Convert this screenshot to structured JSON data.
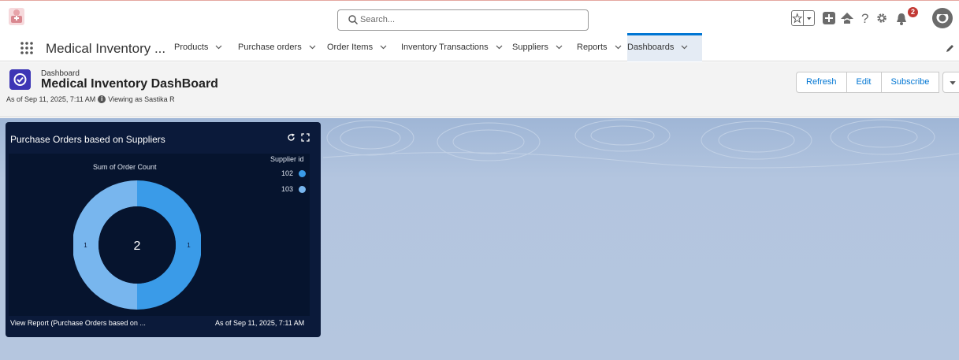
{
  "topbar": {
    "search_placeholder": "Search...",
    "notification_count": "2",
    "icons": [
      "app-logo-icon",
      "search-icon",
      "favorites-star-icon",
      "favorites-dropdown-icon",
      "global-actions-plus-icon",
      "trailhead-icon",
      "help-icon",
      "setup-gear-icon",
      "notifications-bell-icon",
      "user-avatar-icon"
    ]
  },
  "navbar": {
    "app_name": "Medical Inventory ...",
    "items": [
      {
        "label": "Products"
      },
      {
        "label": "Purchase orders"
      },
      {
        "label": "Order Items"
      },
      {
        "label": "Inventory Transactions"
      },
      {
        "label": "Suppliers"
      },
      {
        "label": "Reports"
      },
      {
        "label": "Dashboards"
      }
    ],
    "active_item": "Dashboards"
  },
  "header": {
    "subtitle": "Dashboard",
    "title": "Medical Inventory DashBoard",
    "as_of": "As of Sep 11, 2025, 7:11 AM",
    "viewing_as": "Viewing as Sastika R",
    "buttons": {
      "refresh": "Refresh",
      "edit": "Edit",
      "subscribe": "Subscribe"
    }
  },
  "widget": {
    "title": "Purchase Orders based on Suppliers",
    "footer_link": "View Report (Purchase Orders based on ...",
    "footer_timestamp": "As of Sep 11, 2025, 7:11 AM"
  },
  "chart_data": {
    "type": "pie",
    "subtype": "donut",
    "title": "Sum of Order Count",
    "legend_title": "Supplier id",
    "legend_position": "right",
    "center_total": "2",
    "categories": [
      "102",
      "103"
    ],
    "values": [
      1,
      1
    ],
    "colors": [
      "#3a9be8",
      "#78b6ee"
    ]
  },
  "colors": {
    "accent": "#0176d3",
    "widget_bg": "#0b1a3a",
    "canvas_bg": "#b3c5df",
    "badge": "#c23934"
  }
}
